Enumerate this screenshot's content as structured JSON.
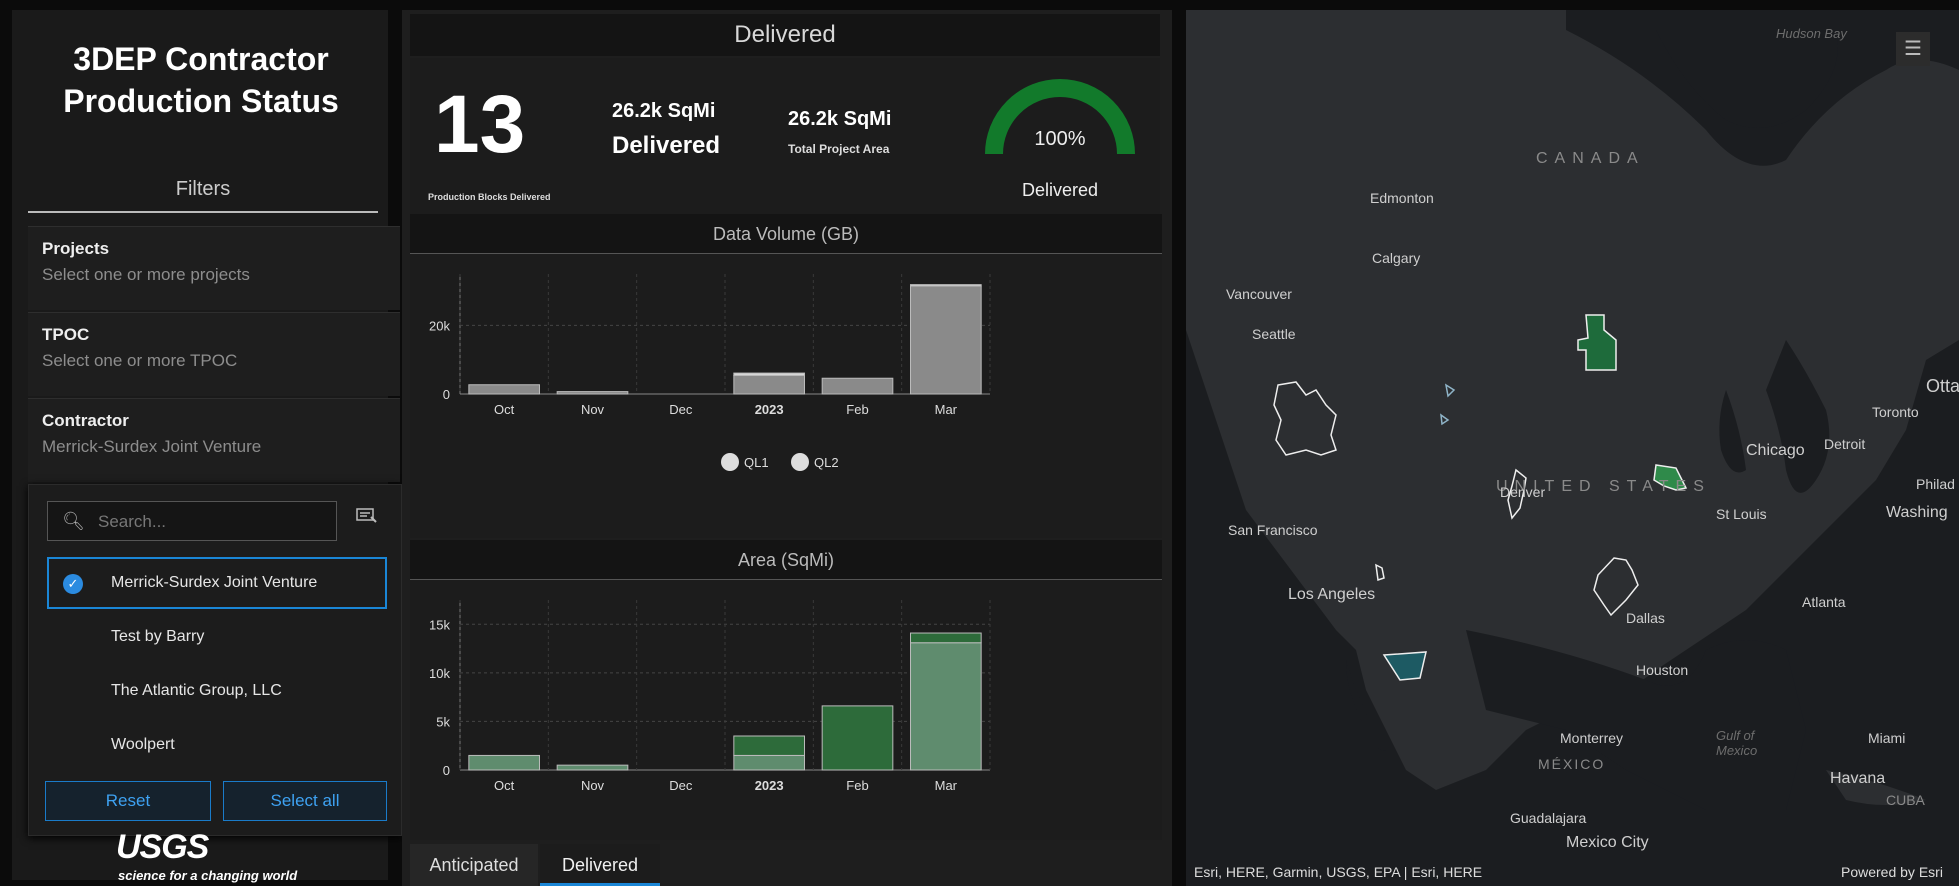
{
  "left_panel": {
    "title": "3DEP Contractor Production Status",
    "filters_label": "Filters",
    "projects": {
      "label": "Projects",
      "placeholder": "Select one or more projects"
    },
    "tpoc": {
      "label": "TPOC",
      "placeholder": "Select one or more TPOC"
    },
    "contractor": {
      "label": "Contractor",
      "value": "Merrick-Surdex Joint Venture"
    },
    "dropdown": {
      "search_placeholder": "Search...",
      "options": [
        {
          "label": "Merrick-Surdex Joint Venture",
          "selected": true
        },
        {
          "label": "Test by Barry",
          "selected": false
        },
        {
          "label": "The Atlantic Group, LLC",
          "selected": false
        },
        {
          "label": "Woolpert",
          "selected": false
        }
      ],
      "reset_label": "Reset",
      "select_all_label": "Select all"
    },
    "logo": {
      "text": "USGS",
      "tagline": "science for a changing world"
    }
  },
  "middle_panel": {
    "header": "Delivered",
    "blocks_count": "13",
    "blocks_label": "Production Blocks Delivered",
    "delivered_area_value": "26.2k SqMi",
    "delivered_area_label": "Delivered",
    "total_area_value": "26.2k SqMi",
    "total_area_label": "Total Project Area",
    "gauge": {
      "value": 100,
      "text": "100%",
      "label": "Delivered",
      "color": "#127a2b"
    },
    "tabs": [
      {
        "label": "Anticipated",
        "active": false
      },
      {
        "label": "Delivered",
        "active": true
      }
    ]
  },
  "chart_data": [
    {
      "type": "bar",
      "title": "Data Volume (GB)",
      "categories": [
        "Oct",
        "Nov",
        "Dec",
        "2023",
        "Feb",
        "Mar"
      ],
      "series": [
        {
          "name": "QL1",
          "values": [
            0,
            0,
            0,
            700,
            0,
            400
          ],
          "color": "#d6d6d6"
        },
        {
          "name": "QL2",
          "values": [
            2700,
            700,
            0,
            5400,
            4600,
            31500
          ],
          "color": "#8a8a8a"
        }
      ],
      "stacked": true,
      "ylim": [
        0,
        35000
      ],
      "yticks": [
        "0",
        "20k"
      ],
      "ytick_values": [
        0,
        20000
      ],
      "legend": "bottom",
      "grid": true
    },
    {
      "type": "bar",
      "title": "Area (SqMi)",
      "categories": [
        "Oct",
        "Nov",
        "Dec",
        "2023",
        "Feb",
        "Mar"
      ],
      "series": [
        {
          "name": "QL1",
          "values": [
            0,
            0,
            0,
            2000,
            6600,
            1000
          ],
          "color": "#2d6b3a"
        },
        {
          "name": "QL2",
          "values": [
            1500,
            500,
            0,
            1500,
            0,
            13100
          ],
          "color": "#5f8c6e"
        }
      ],
      "stacked": true,
      "ylim": [
        0,
        17500
      ],
      "yticks": [
        "0",
        "5k",
        "10k",
        "15k"
      ],
      "ytick_values": [
        0,
        5000,
        10000,
        15000
      ],
      "grid": true
    }
  ],
  "map": {
    "labels": {
      "hudson_bay": "Hudson Bay",
      "canada": "CANADA",
      "edmonton": "Edmonton",
      "calgary": "Calgary",
      "vancouver": "Vancouver",
      "seattle": "Seattle",
      "toronto": "Toronto",
      "ottawa": "Otta",
      "detroit": "Detroit",
      "chicago": "Chicago",
      "philadelphia": "Philad",
      "washington": "Washing",
      "united_states": "UNITED STATES",
      "denver": "Denver",
      "st_louis": "St Louis",
      "san_francisco": "San Francisco",
      "los_angeles": "Los Angeles",
      "dallas": "Dallas",
      "atlanta": "Atlanta",
      "houston": "Houston",
      "monterrey": "Monterrey",
      "mexico": "MÉXICO",
      "gulf": "Gulf of Mexico",
      "miami": "Miami",
      "havana": "Havana",
      "cuba": "CUBA",
      "guadalajara": "Guadalajara",
      "mexico_city": "Mexico City"
    },
    "attribution": "Esri, HERE, Garmin, USGS, EPA | Esri, HERE",
    "powered_by": "Powered by Esri"
  }
}
